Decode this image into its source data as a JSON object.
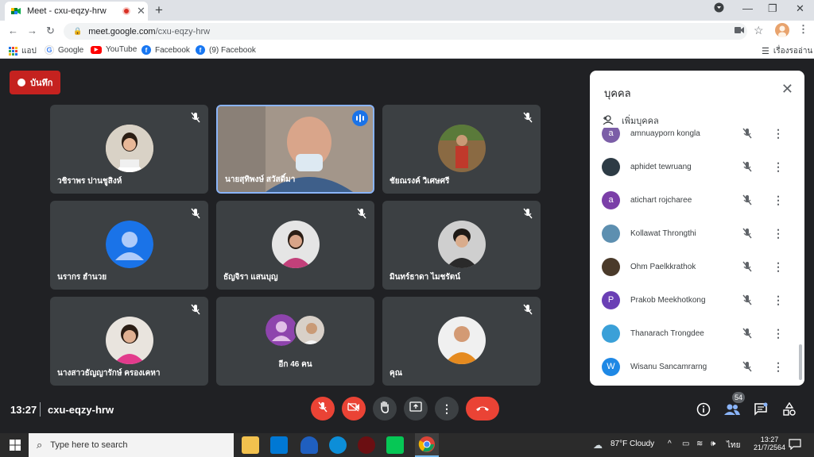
{
  "browser": {
    "tab_title": "Meet - cxu-eqzy-hrw",
    "url_host": "meet.google.com",
    "url_path": "/cxu-eqzy-hrw",
    "bookmarks": [
      {
        "label": "แอป",
        "icon": "apps-grid-icon"
      },
      {
        "label": "Google",
        "icon": "google-icon"
      },
      {
        "label": "YouTube",
        "icon": "youtube-icon"
      },
      {
        "label": "Facebook",
        "icon": "facebook-icon"
      },
      {
        "label": "(9) Facebook",
        "icon": "facebook-icon"
      }
    ],
    "reading_list": "เรื่องรออ่าน"
  },
  "meet": {
    "record_label": "บันทึก",
    "tiles": [
      {
        "name": "วชิราพร ปานชูสิงห์",
        "mic_off": true
      },
      {
        "name": "นายสุทิพงษ์ สวัสดิ์มา",
        "speaking": true
      },
      {
        "name": "ชัยณรงค์ วิเศษศรี",
        "mic_off": true
      },
      {
        "name": "นรากร ฮำนวย",
        "mic_off": true
      },
      {
        "name": "ธัญจิรา แสนบุญ",
        "mic_off": true
      },
      {
        "name": "มินทร์ธาดา ไมชรัตน์",
        "mic_off": true
      },
      {
        "name": "นางสาวธัญญารักษ์ ครองเคหา",
        "mic_off": true
      },
      {
        "name": "อีก 46 คน"
      },
      {
        "name": "คุณ",
        "mic_off": true
      }
    ],
    "clock": "13:27",
    "meeting_code": "cxu-eqzy-hrw",
    "participants_count": "54",
    "panel": {
      "title": "บุคคล",
      "add_label": "เพิ่มบุคคล",
      "people": [
        {
          "name": "amnuayporn kongla",
          "initial": "a",
          "color": "#7b5ea7"
        },
        {
          "name": "aphidet tewruang",
          "initial": "",
          "color": "#2d3b45"
        },
        {
          "name": "atichart rojcharee",
          "initial": "a",
          "color": "#7b3fa8"
        },
        {
          "name": "Kollawat Throngthi",
          "initial": "",
          "color": "#5d8fb0"
        },
        {
          "name": "Ohm Paelkkrathok",
          "initial": "",
          "color": "#4a3a2a"
        },
        {
          "name": "Prakob Meekhotkong",
          "initial": "P",
          "color": "#6a3fb5"
        },
        {
          "name": "Thanarach Trongdee",
          "initial": "",
          "color": "#3aa0d8"
        },
        {
          "name": "Wisanu Sancamrarng",
          "initial": "W",
          "color": "#1e88e5"
        }
      ]
    }
  },
  "taskbar": {
    "search_placeholder": "Type here to search",
    "weather": "87°F  Cloudy",
    "lang": "ไทย",
    "time": "13:27",
    "date": "21/7/2564"
  }
}
